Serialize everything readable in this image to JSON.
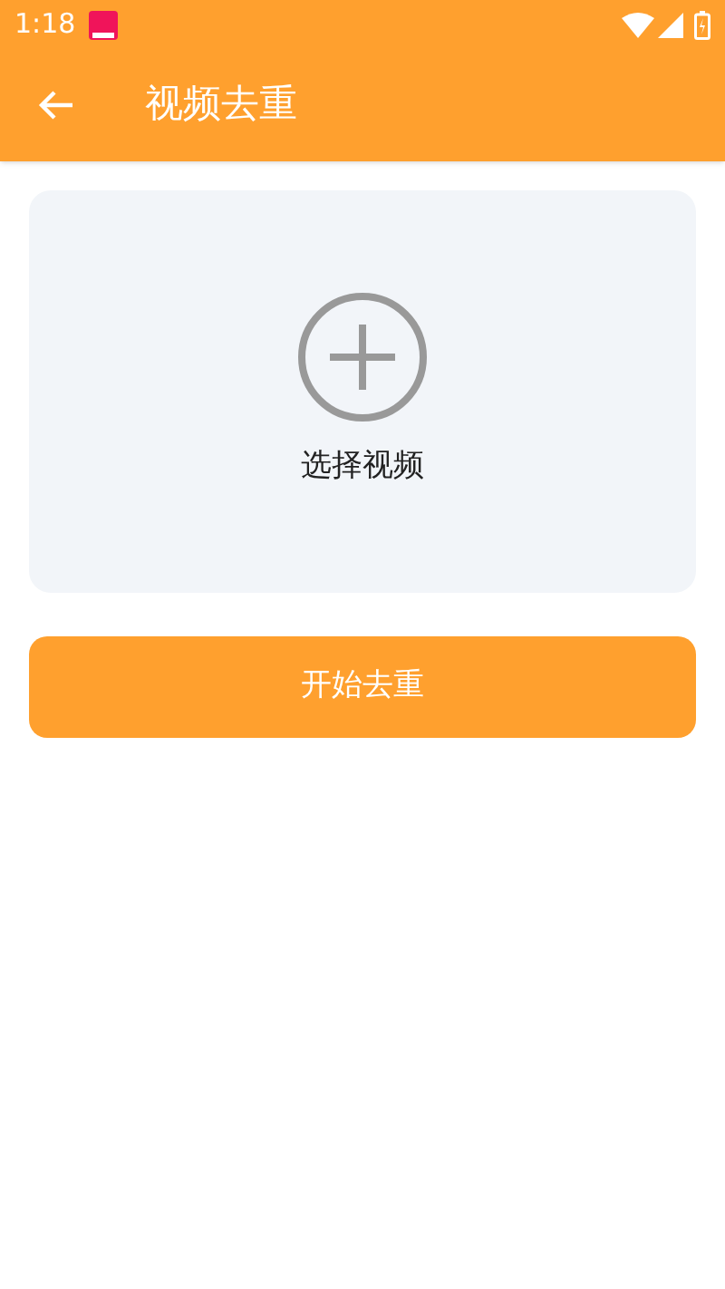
{
  "status_bar": {
    "time": "1:18"
  },
  "app_bar": {
    "title": "视频去重"
  },
  "picker": {
    "label": "选择视频"
  },
  "buttons": [
    "开始去重"
  ]
}
